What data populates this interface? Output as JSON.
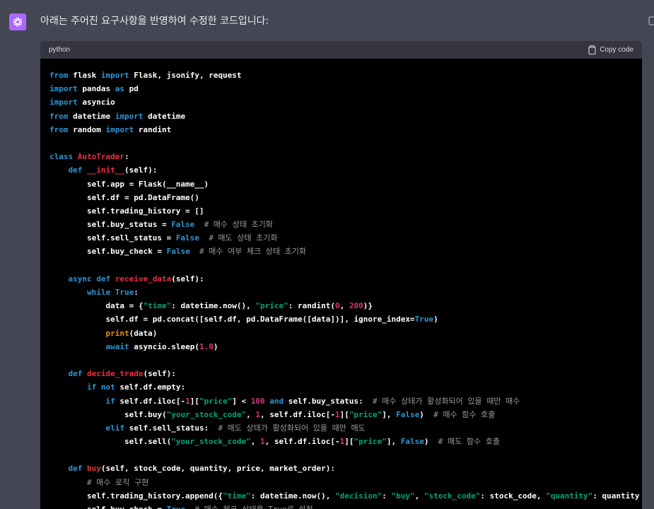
{
  "message": {
    "intro": "아래는 주어진 요구사항을 반영하여 수정한 코드입니다:"
  },
  "code_block": {
    "language": "python",
    "copy_label": "Copy code"
  },
  "code_lines": [
    [
      {
        "t": "from",
        "c": "kw"
      },
      {
        "t": " flask "
      },
      {
        "t": "import",
        "c": "kw"
      },
      {
        "t": " Flask, jsonify, request"
      }
    ],
    [
      {
        "t": "import",
        "c": "kw"
      },
      {
        "t": " pandas "
      },
      {
        "t": "as",
        "c": "kw"
      },
      {
        "t": " pd"
      }
    ],
    [
      {
        "t": "import",
        "c": "kw"
      },
      {
        "t": " asyncio"
      }
    ],
    [
      {
        "t": "from",
        "c": "kw"
      },
      {
        "t": " datetime "
      },
      {
        "t": "import",
        "c": "kw"
      },
      {
        "t": " datetime"
      }
    ],
    [
      {
        "t": "from",
        "c": "kw"
      },
      {
        "t": " random "
      },
      {
        "t": "import",
        "c": "kw"
      },
      {
        "t": " randint"
      }
    ],
    [],
    [
      {
        "t": "class",
        "c": "kw"
      },
      {
        "t": " "
      },
      {
        "t": "AutoTrader",
        "c": "title"
      },
      {
        "t": ":"
      }
    ],
    [
      {
        "t": "    "
      },
      {
        "t": "def",
        "c": "kw"
      },
      {
        "t": " "
      },
      {
        "t": "__init__",
        "c": "title"
      },
      {
        "t": "(self):"
      }
    ],
    [
      {
        "t": "        self.app = Flask(__name__)"
      }
    ],
    [
      {
        "t": "        self.df = pd.DataFrame()"
      }
    ],
    [
      {
        "t": "        self.trading_history = []"
      }
    ],
    [
      {
        "t": "        self.buy_status = "
      },
      {
        "t": "False",
        "c": "kw"
      },
      {
        "t": "  "
      },
      {
        "t": "# 매수 상태 초기화",
        "c": "cm"
      }
    ],
    [
      {
        "t": "        self.sell_status = "
      },
      {
        "t": "False",
        "c": "kw"
      },
      {
        "t": "  "
      },
      {
        "t": "# 매도 상태 초기화",
        "c": "cm"
      }
    ],
    [
      {
        "t": "        self.buy_check = "
      },
      {
        "t": "False",
        "c": "kw"
      },
      {
        "t": "  "
      },
      {
        "t": "# 매수 여부 체크 상태 초기화",
        "c": "cm"
      }
    ],
    [],
    [
      {
        "t": "    "
      },
      {
        "t": "async",
        "c": "kw"
      },
      {
        "t": " "
      },
      {
        "t": "def",
        "c": "kw"
      },
      {
        "t": " "
      },
      {
        "t": "receive_data",
        "c": "title"
      },
      {
        "t": "(self):"
      }
    ],
    [
      {
        "t": "        "
      },
      {
        "t": "while",
        "c": "kw"
      },
      {
        "t": " "
      },
      {
        "t": "True",
        "c": "kw"
      },
      {
        "t": ":"
      }
    ],
    [
      {
        "t": "            data = {"
      },
      {
        "t": "\"time\"",
        "c": "str"
      },
      {
        "t": ": datetime.now(), "
      },
      {
        "t": "\"price\"",
        "c": "str"
      },
      {
        "t": ": randint("
      },
      {
        "t": "0",
        "c": "num"
      },
      {
        "t": ", "
      },
      {
        "t": "200",
        "c": "num"
      },
      {
        "t": ")}"
      }
    ],
    [
      {
        "t": "            self.df = pd.concat([self.df, pd.DataFrame([data])], ignore_index="
      },
      {
        "t": "True",
        "c": "kw"
      },
      {
        "t": ")"
      }
    ],
    [
      {
        "t": "            "
      },
      {
        "t": "print",
        "c": "bi"
      },
      {
        "t": "(data)"
      }
    ],
    [
      {
        "t": "            "
      },
      {
        "t": "await",
        "c": "kw"
      },
      {
        "t": " asyncio.sleep("
      },
      {
        "t": "1.0",
        "c": "num"
      },
      {
        "t": ")"
      }
    ],
    [],
    [
      {
        "t": "    "
      },
      {
        "t": "def",
        "c": "kw"
      },
      {
        "t": " "
      },
      {
        "t": "decide_trade",
        "c": "title"
      },
      {
        "t": "(self):"
      }
    ],
    [
      {
        "t": "        "
      },
      {
        "t": "if",
        "c": "kw"
      },
      {
        "t": " "
      },
      {
        "t": "not",
        "c": "kw"
      },
      {
        "t": " self.df.empty:"
      }
    ],
    [
      {
        "t": "            "
      },
      {
        "t": "if",
        "c": "kw"
      },
      {
        "t": " self.df.iloc[-"
      },
      {
        "t": "1",
        "c": "num"
      },
      {
        "t": "]["
      },
      {
        "t": "\"price\"",
        "c": "str"
      },
      {
        "t": "] < "
      },
      {
        "t": "100",
        "c": "num"
      },
      {
        "t": " "
      },
      {
        "t": "and",
        "c": "kw"
      },
      {
        "t": " self.buy_status:  "
      },
      {
        "t": "# 매수 상태가 활성화되어 있을 때만 매수",
        "c": "cm"
      }
    ],
    [
      {
        "t": "                self.buy("
      },
      {
        "t": "\"your_stock_code\"",
        "c": "str"
      },
      {
        "t": ", "
      },
      {
        "t": "1",
        "c": "num"
      },
      {
        "t": ", self.df.iloc[-"
      },
      {
        "t": "1",
        "c": "num"
      },
      {
        "t": "]["
      },
      {
        "t": "\"price\"",
        "c": "str"
      },
      {
        "t": "], "
      },
      {
        "t": "False",
        "c": "kw"
      },
      {
        "t": ")  "
      },
      {
        "t": "# 매수 함수 호출",
        "c": "cm"
      }
    ],
    [
      {
        "t": "            "
      },
      {
        "t": "elif",
        "c": "kw"
      },
      {
        "t": " self.sell_status:  "
      },
      {
        "t": "# 매도 상태가 활성화되어 있을 때만 매도",
        "c": "cm"
      }
    ],
    [
      {
        "t": "                self.sell("
      },
      {
        "t": "\"your_stock_code\"",
        "c": "str"
      },
      {
        "t": ", "
      },
      {
        "t": "1",
        "c": "num"
      },
      {
        "t": ", self.df.iloc[-"
      },
      {
        "t": "1",
        "c": "num"
      },
      {
        "t": "]["
      },
      {
        "t": "\"price\"",
        "c": "str"
      },
      {
        "t": "], "
      },
      {
        "t": "False",
        "c": "kw"
      },
      {
        "t": ")  "
      },
      {
        "t": "# 매도 함수 호출",
        "c": "cm"
      }
    ],
    [],
    [
      {
        "t": "    "
      },
      {
        "t": "def",
        "c": "kw"
      },
      {
        "t": " "
      },
      {
        "t": "buy",
        "c": "title"
      },
      {
        "t": "(self, stock_code, quantity, price, market_order):"
      }
    ],
    [
      {
        "t": "        "
      },
      {
        "t": "# 매수 로직 구현",
        "c": "cm"
      }
    ],
    [
      {
        "t": "        self.trading_history.append({"
      },
      {
        "t": "\"time\"",
        "c": "str"
      },
      {
        "t": ": datetime.now(), "
      },
      {
        "t": "\"decision\"",
        "c": "str"
      },
      {
        "t": ": "
      },
      {
        "t": "\"buy\"",
        "c": "str"
      },
      {
        "t": ", "
      },
      {
        "t": "\"stock_code\"",
        "c": "str"
      },
      {
        "t": ": stock_code, "
      },
      {
        "t": "\"quantity\"",
        "c": "str"
      },
      {
        "t": ": quantity"
      }
    ],
    [
      {
        "t": "        self.buy_check = "
      },
      {
        "t": "True",
        "c": "kw"
      },
      {
        "t": "  "
      },
      {
        "t": "# 매수 체크 상태를 True로 설정",
        "c": "cm"
      }
    ]
  ]
}
